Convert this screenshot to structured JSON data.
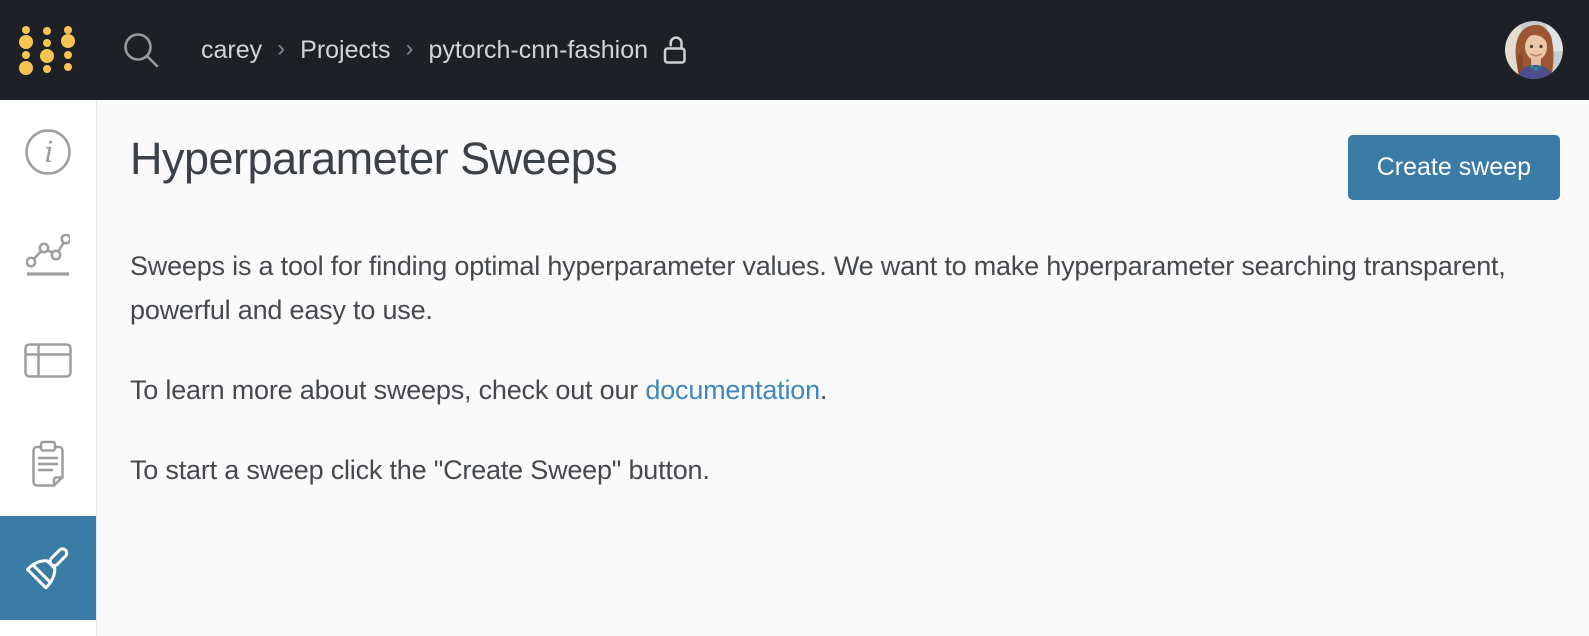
{
  "navbar": {
    "breadcrumb": {
      "user": "carey",
      "section": "Projects",
      "project": "pytorch-cnn-fashion",
      "separator": "›"
    },
    "icons": [
      "wandb-logo-dots",
      "search-icon",
      "unlock-icon",
      "user-avatar"
    ]
  },
  "sidebar": {
    "items": [
      {
        "id": "overview",
        "icon": "info-icon",
        "active": false
      },
      {
        "id": "charts",
        "icon": "line-chart-icon",
        "active": false
      },
      {
        "id": "table",
        "icon": "table-icon",
        "active": false
      },
      {
        "id": "notes",
        "icon": "clipboard-icon",
        "active": false
      },
      {
        "id": "sweeps",
        "icon": "broom-icon",
        "active": true
      }
    ]
  },
  "main": {
    "title": "Hyperparameter Sweeps",
    "create_sweep_button": "Create sweep",
    "paragraph1": "Sweeps is a tool for finding optimal hyperparameter values. We want to make hyperparameter searching transparent, powerful and easy to use.",
    "paragraph2_prefix": "To learn more about sweeps, check out our ",
    "paragraph2_link": "documentation",
    "paragraph2_suffix": ".",
    "paragraph3": "To start a sweep click the \"Create Sweep\" button."
  },
  "colors": {
    "navbar_bg": "#1d2126",
    "logo_gold": "#f6c451",
    "accent_blue": "#3a7ca5",
    "link_blue": "#3e87c1",
    "content_bg": "#fafafa",
    "sidebar_icon_gray": "#9b9ea1",
    "breadcrumb_text": "#d3d5d7",
    "title_text": "#3b4147",
    "body_text": "#45494e"
  }
}
